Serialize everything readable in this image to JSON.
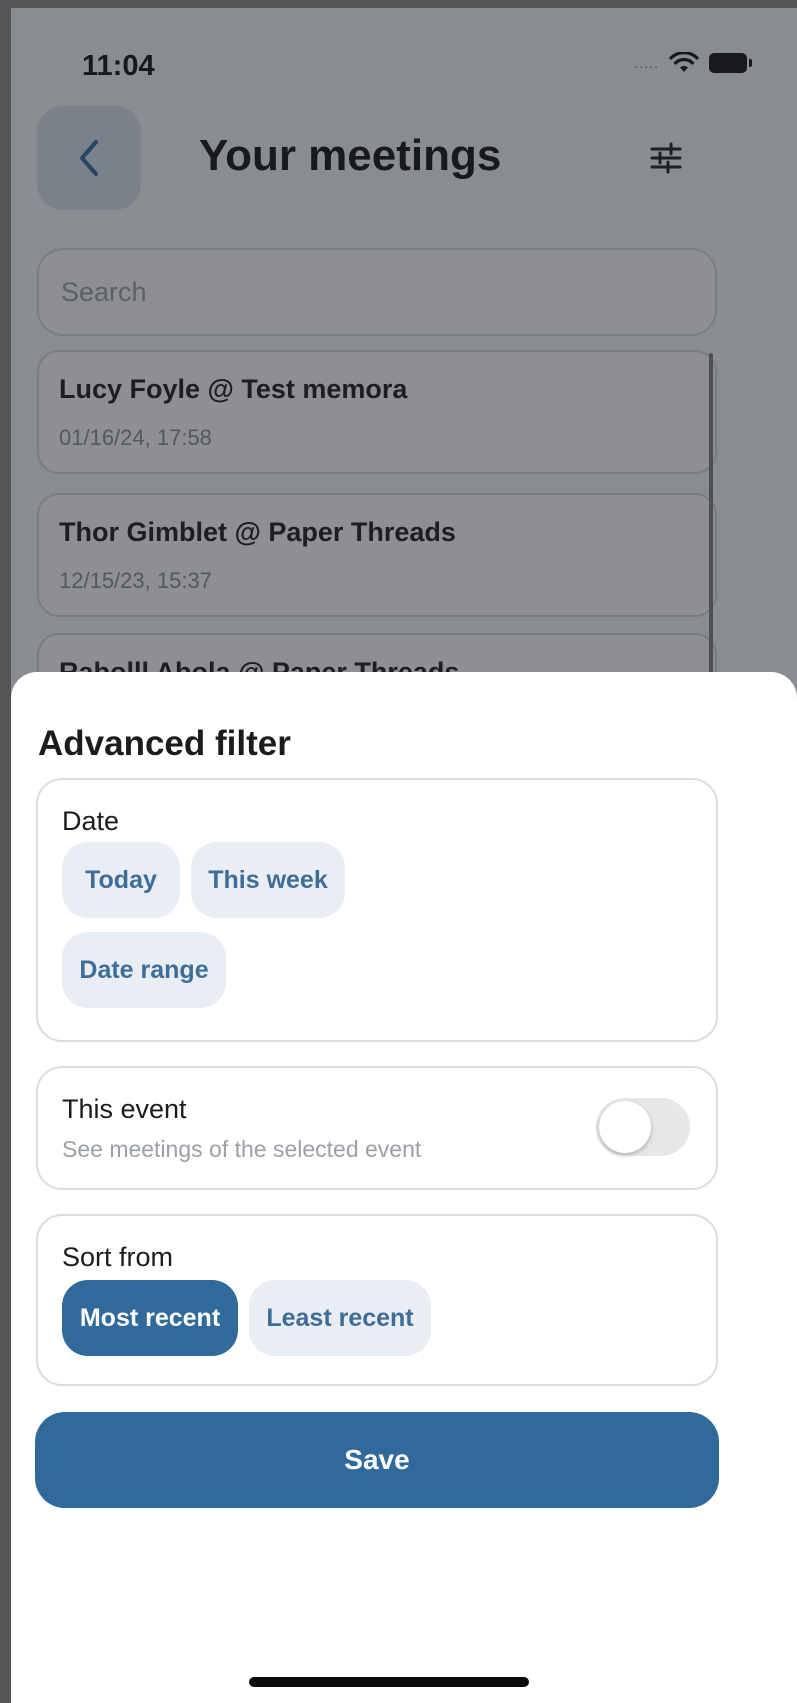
{
  "status_bar": {
    "time": "11:04",
    "signal": "....."
  },
  "header": {
    "title": "Your meetings"
  },
  "search": {
    "placeholder": "Search"
  },
  "meetings": [
    {
      "title": "Lucy Foyle @ Test memora",
      "datetime": "01/16/24, 17:58"
    },
    {
      "title": "Thor Gimblet @ Paper Threads",
      "datetime": "12/15/23, 15:37"
    },
    {
      "title": "Rabolll Abola @ Paper Threads",
      "datetime": ""
    }
  ],
  "filter_sheet": {
    "title": "Advanced filter",
    "date_section": {
      "label": "Date",
      "options": [
        "Today",
        "This week",
        "Date range"
      ]
    },
    "event_section": {
      "label": "This event",
      "sublabel": "See meetings of the selected event",
      "toggle_on": false
    },
    "sort_section": {
      "label": "Sort from",
      "options": [
        "Most recent",
        "Least recent"
      ],
      "selected": "Most recent"
    },
    "save_label": "Save"
  },
  "colors": {
    "accent": "#2f6a9b",
    "chip_bg": "#e8eef4",
    "chip_text": "#3e6d98",
    "overlay": "rgba(30,34,40,0.5)"
  }
}
